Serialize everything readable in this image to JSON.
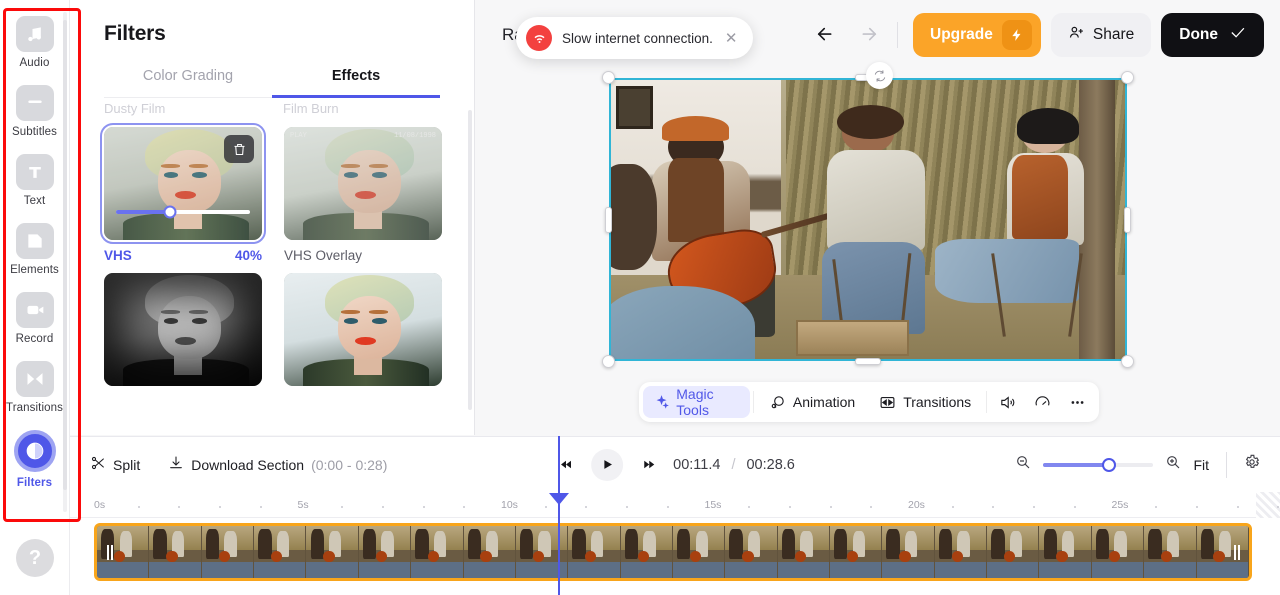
{
  "sidebar": {
    "items": [
      {
        "label": "Audio",
        "icon": "music-note-icon",
        "active": false
      },
      {
        "label": "Subtitles",
        "icon": "subtitles-icon",
        "active": false
      },
      {
        "label": "Text",
        "icon": "text-icon",
        "active": false
      },
      {
        "label": "Elements",
        "icon": "elements-icon",
        "active": false
      },
      {
        "label": "Record",
        "icon": "record-camera-icon",
        "active": false
      },
      {
        "label": "Transitions",
        "icon": "transitions-icon",
        "active": false
      },
      {
        "label": "Filters",
        "icon": "contrast-filter-icon",
        "active": true
      }
    ],
    "help_label": "?"
  },
  "panel": {
    "title": "Filters",
    "tabs": [
      {
        "label": "Color Grading",
        "active": false
      },
      {
        "label": "Effects",
        "active": true
      }
    ],
    "scrolled_row_labels": [
      "Dusty Film",
      "Film Burn"
    ],
    "filters": [
      {
        "name": "VHS",
        "value_label": "40%",
        "value_pct": 40,
        "selected": true,
        "has_delete": true,
        "thumb_style": "vhs"
      },
      {
        "name": "VHS Overlay",
        "value_label": "",
        "selected": false,
        "has_delete": false,
        "thumb_style": "overlay",
        "overlay_left_text": "PLAY",
        "overlay_right_text": "11/08/1998"
      },
      {
        "name": "",
        "value_label": "",
        "selected": false,
        "has_delete": false,
        "thumb_style": "bw"
      },
      {
        "name": "",
        "value_label": "",
        "selected": false,
        "has_delete": false,
        "thumb_style": "pale"
      }
    ]
  },
  "topbar": {
    "project_title": "Rabia",
    "toast": {
      "message": "Slow internet connection.",
      "icon": "wifi-off-icon",
      "close_icon": "close-icon",
      "accent": "#f3413f"
    },
    "undo_icon": "undo-arrow-icon",
    "redo_icon": "redo-arrow-icon",
    "sync_icon": "sync-refresh-icon",
    "upgrade_label": "Upgrade",
    "upgrade_icon": "lightning-bolt-icon",
    "upgrade_color": "#fba428",
    "share_label": "Share",
    "share_icon": "person-add-icon",
    "done_label": "Done",
    "done_icon": "check-icon",
    "done_color": "#101014"
  },
  "tools": [
    {
      "label": "Magic Tools",
      "icon": "sparkles-icon",
      "active": true
    },
    {
      "label": "Animation",
      "icon": "animation-circles-icon",
      "active": false
    },
    {
      "label": "Transitions",
      "icon": "transitions-bowtie-icon",
      "active": false
    },
    {
      "label": "",
      "icon": "volume-icon",
      "active": false
    },
    {
      "label": "",
      "icon": "speed-gauge-icon",
      "active": false
    },
    {
      "label": "",
      "icon": "more-dots-icon",
      "active": false
    }
  ],
  "timeline": {
    "split_label": "Split",
    "split_icon": "scissors-icon",
    "download_label": "Download Section",
    "download_range": "(0:00 - 0:28)",
    "download_icon": "download-icon",
    "skip_back_icon": "skip-back-icon",
    "play_icon": "play-icon",
    "skip_forward_icon": "skip-forward-icon",
    "current_time": "00:11.4",
    "separator": "/",
    "total_time": "00:28.6",
    "zoom_out_icon": "zoom-out-icon",
    "zoom_in_icon": "zoom-in-icon",
    "zoom_pct": 60,
    "fit_label": "Fit",
    "gear_icon": "gear-icon",
    "ruler_labels": [
      "0s",
      "5s",
      "10s",
      "15s",
      "20s",
      "25s"
    ],
    "playhead_time_s": 11.4,
    "clip_color": "#f8a51b"
  },
  "colors": {
    "accent_purple": "#4f57e8",
    "annotation_red": "#fb0a0a",
    "selection_cyan": "#31b5d6"
  }
}
